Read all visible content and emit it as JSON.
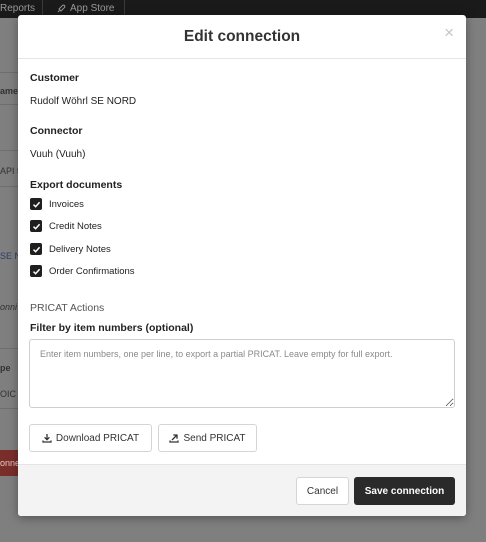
{
  "background": {
    "nav": {
      "reports_label": "Reports",
      "app_store_label": "App Store"
    },
    "side_texts": [
      "ame",
      "API t",
      "SE N",
      "onni",
      "pe",
      "OIC",
      "onne"
    ]
  },
  "modal": {
    "title": "Edit connection",
    "close_label": "×",
    "customer": {
      "label": "Customer",
      "value": "Rudolf Wöhrl SE NORD"
    },
    "connector": {
      "label": "Connector",
      "value": "Vuuh (Vuuh)"
    },
    "export_documents": {
      "label": "Export documents",
      "items": [
        {
          "label": "Invoices",
          "checked": true
        },
        {
          "label": "Credit Notes",
          "checked": true
        },
        {
          "label": "Delivery Notes",
          "checked": true
        },
        {
          "label": "Order Confirmations",
          "checked": true
        }
      ]
    },
    "pricat": {
      "section_title": "PRICAT Actions",
      "filter_label": "Filter by item numbers (optional)",
      "filter_value": "",
      "filter_placeholder": "Enter item numbers, one per line, to export a partial PRICAT. Leave empty for full export.",
      "download_label": "Download PRICAT",
      "send_label": "Send PRICAT"
    },
    "footer": {
      "cancel_label": "Cancel",
      "save_label": "Save connection"
    }
  },
  "colors": {
    "primary_button": "#2a2a2a",
    "checkbox": "#1f1f1f",
    "backdrop": "#7f7f7f",
    "top_bar": "#1a1a1a"
  },
  "icons": {
    "download": "download-icon",
    "send": "send-icon",
    "app_store": "rocket-icon",
    "checkbox": "checkmark-icon"
  }
}
